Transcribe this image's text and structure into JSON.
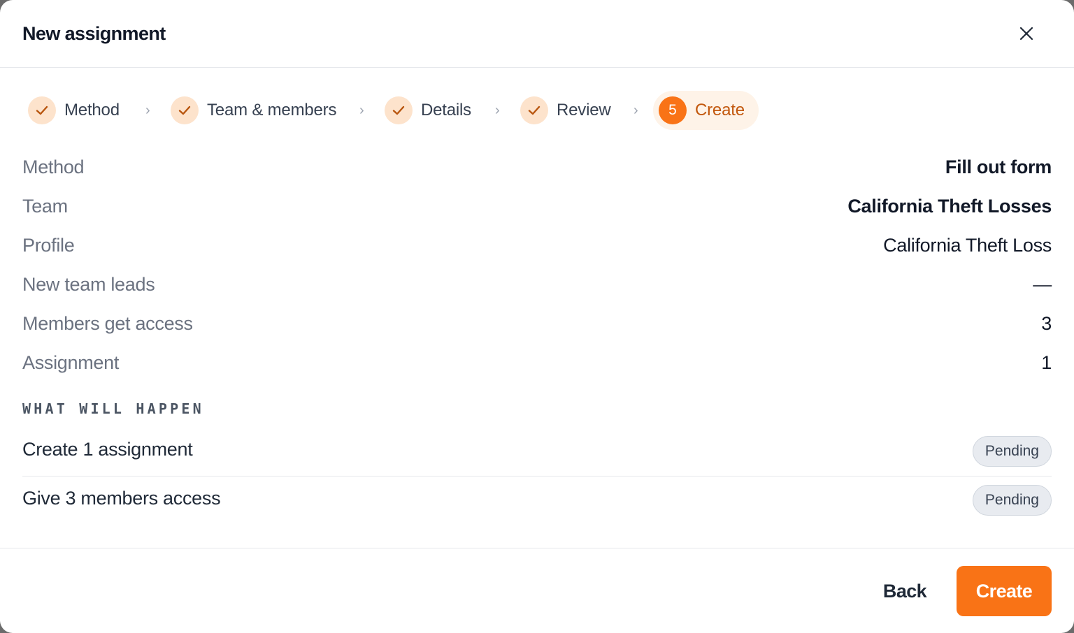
{
  "dialog": {
    "title": "New assignment",
    "close_icon": "close-icon"
  },
  "stepper": {
    "steps": [
      {
        "label": "Method",
        "state": "complete",
        "icon": "check-icon"
      },
      {
        "label": "Team & members",
        "state": "complete",
        "icon": "check-icon"
      },
      {
        "label": "Details",
        "state": "complete",
        "icon": "check-icon"
      },
      {
        "label": "Review",
        "state": "complete",
        "icon": "check-icon"
      },
      {
        "label": "Create",
        "state": "active",
        "number": "5"
      }
    ],
    "separator_icon": "chevron-right-icon"
  },
  "summary": [
    {
      "key": "Method",
      "value": "Fill out form"
    },
    {
      "key": "Team",
      "value": "California Theft Losses"
    },
    {
      "key": "Profile",
      "value": "California Theft Loss"
    },
    {
      "key": "New team leads",
      "value": "—"
    },
    {
      "key": "Members get access",
      "value": "3"
    },
    {
      "key": "Assignment",
      "value": "1"
    }
  ],
  "what_will_happen": {
    "heading": "WHAT WILL HAPPEN",
    "items": [
      {
        "text": "Create 1 assignment",
        "status": "Pending"
      },
      {
        "text": "Give 3 members access",
        "status": "Pending"
      }
    ]
  },
  "footer": {
    "back_label": "Back",
    "create_label": "Create"
  },
  "colors": {
    "accent": "#f97316",
    "accent_soft": "#fde3cc",
    "active_step_bg": "#fef3e8",
    "active_step_text": "#c2570c",
    "badge_bg": "#e8ebf0",
    "muted_text": "#6b7280",
    "primary_text": "#111827"
  }
}
